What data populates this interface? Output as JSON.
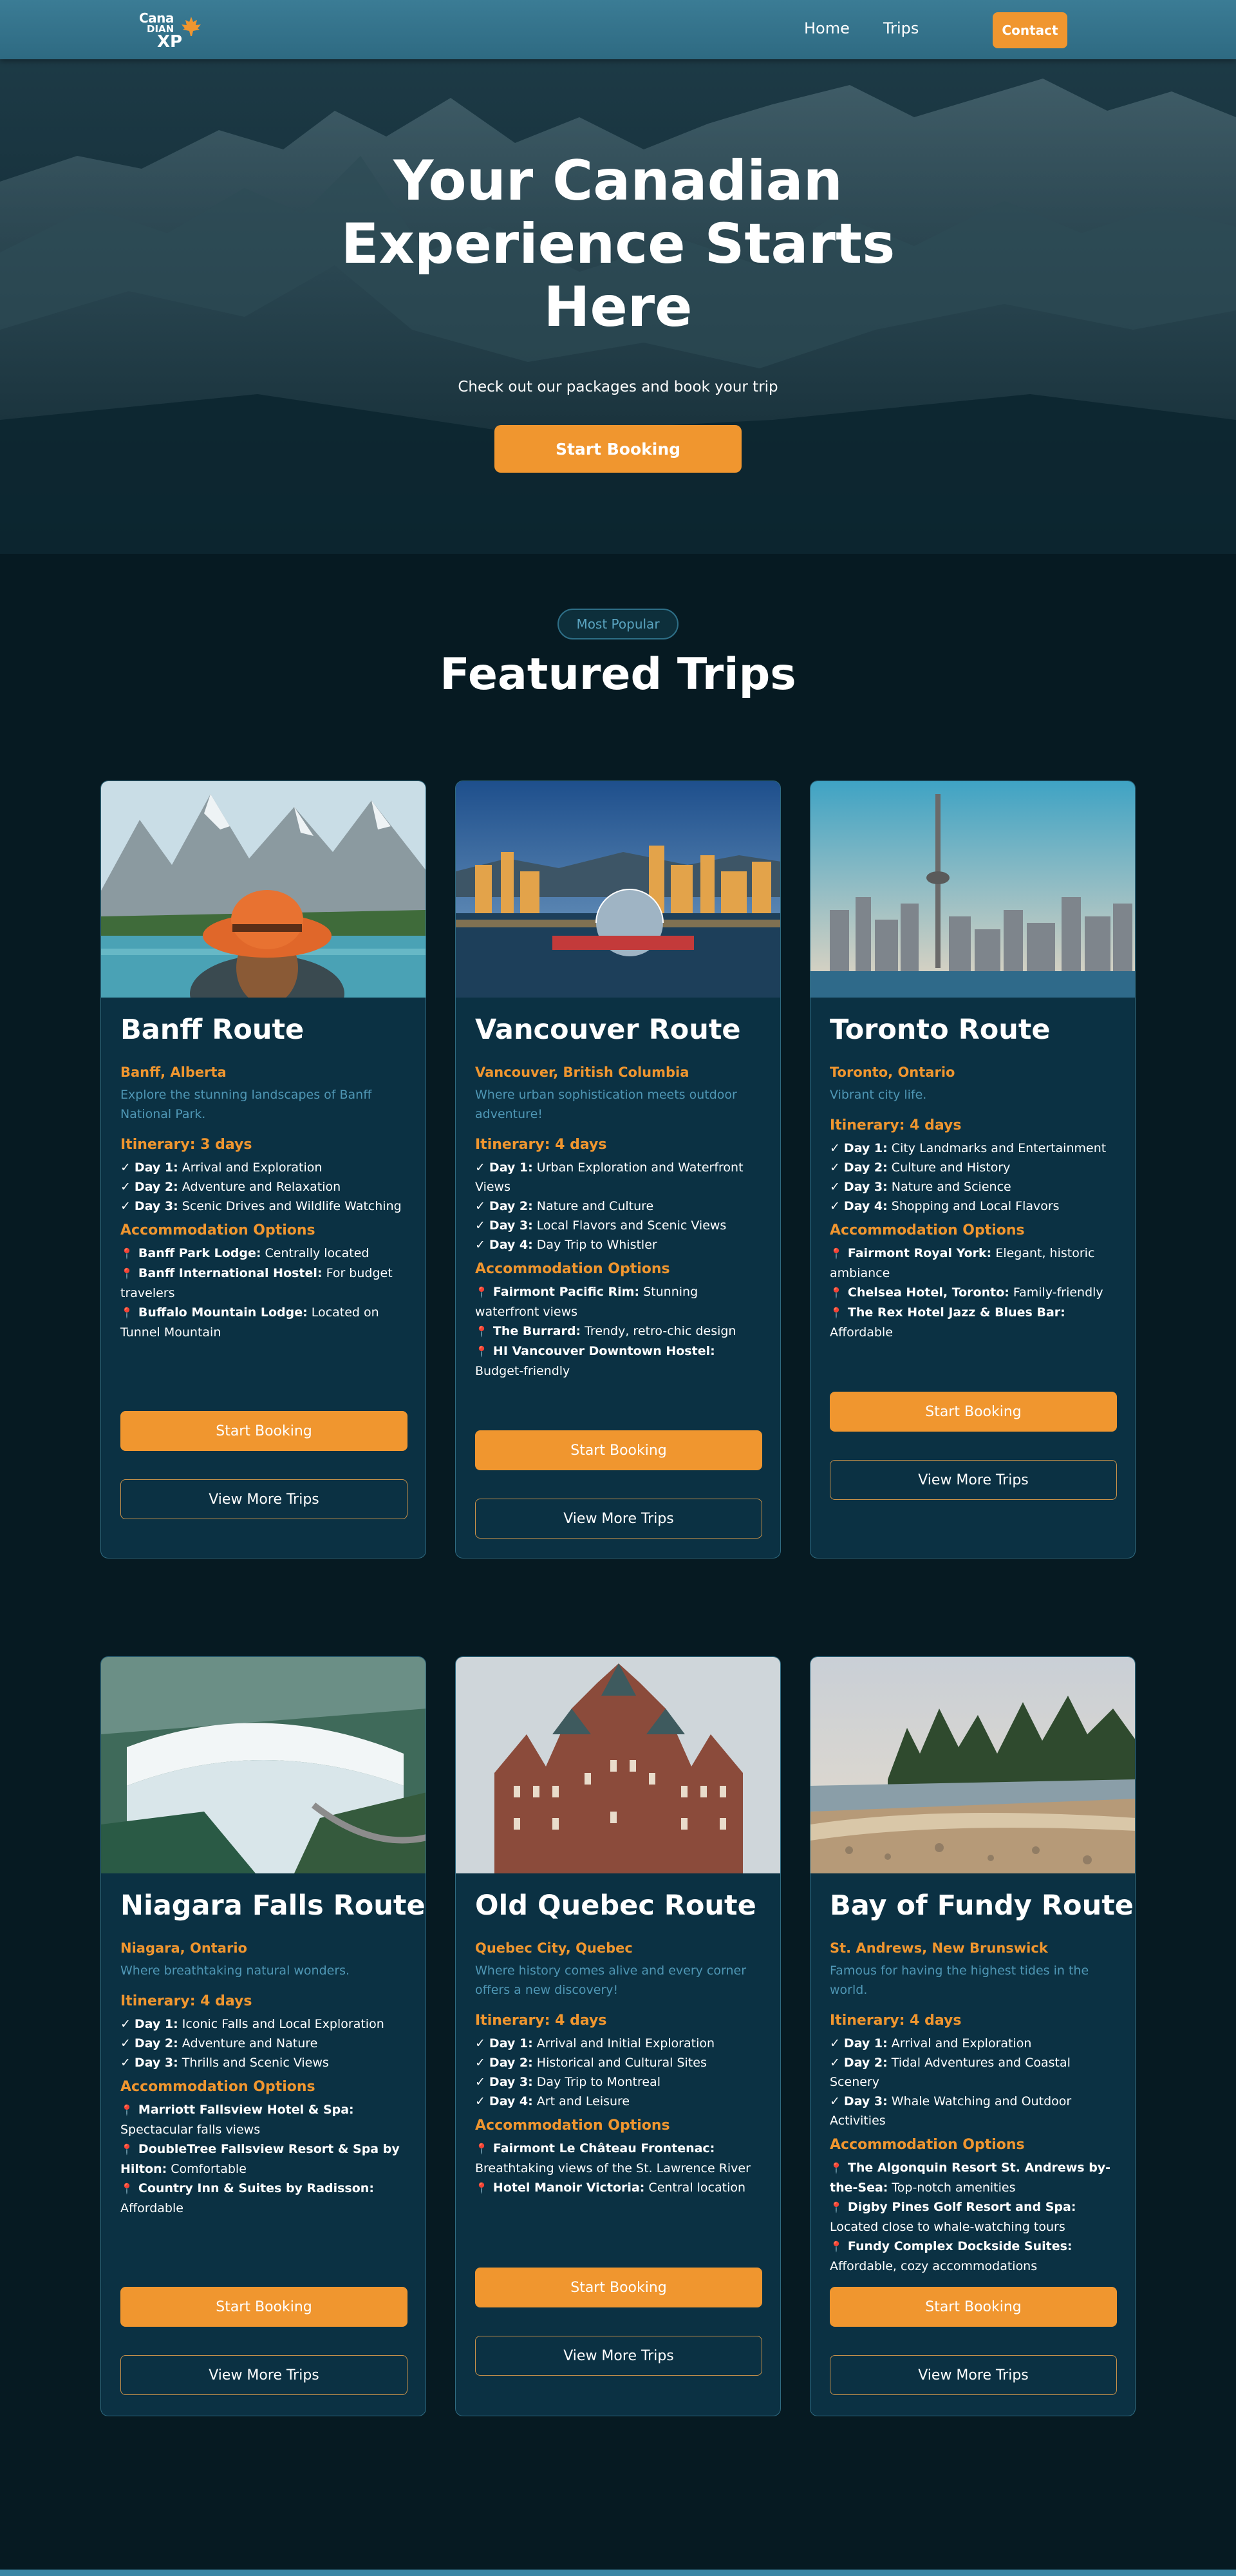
{
  "nav": {
    "logo_line1": "Cana",
    "logo_line2": "DIAN",
    "logo_line3": "XP",
    "home": "Home",
    "trips": "Trips",
    "contact": "Contact"
  },
  "hero": {
    "title": "Your Canadian Experience Starts Here",
    "subtitle": "Check out our packages and book your trip",
    "button": "Start Booking"
  },
  "featured": {
    "badge": "Most Popular",
    "title": "Featured Trips"
  },
  "common": {
    "itinerary_prefix": "Itinerary: ",
    "accommodation_heading": "Accommodation Options",
    "book_label": "Start Booking",
    "more_label": "View More Trips"
  },
  "trips": [
    {
      "title": "Banff Route",
      "location": "Banff, Alberta",
      "description": "Explore the stunning landscapes of Banff National Park.",
      "itinerary": "Itinerary: 3 days",
      "days": [
        {
          "day": "Day 1:",
          "text": "Arrival and Exploration"
        },
        {
          "day": "Day 2:",
          "text": "Adventure and Relaxation"
        },
        {
          "day": "Day 3:",
          "text": "Scenic Drives and Wildlife Watching"
        }
      ],
      "accommodation_heading": "Accommodation Options",
      "hotels": [
        {
          "name": "Banff Park Lodge:",
          "text": "Centrally located"
        },
        {
          "name": "Banff International Hostel:",
          "text": "For budget travelers"
        },
        {
          "name": "Buffalo Mountain Lodge:",
          "text": "Located on Tunnel Mountain"
        }
      ],
      "book": "Start Booking",
      "more": "View More Trips"
    },
    {
      "title": "Vancouver Route",
      "location": "Vancouver, British Columbia",
      "description": "Where urban sophistication meets outdoor adventure!",
      "itinerary": "Itinerary: 4 days",
      "days": [
        {
          "day": "Day 1:",
          "text": "Urban Exploration and Waterfront Views"
        },
        {
          "day": "Day 2:",
          "text": "Nature and Culture"
        },
        {
          "day": "Day 3:",
          "text": "Local Flavors and Scenic Views"
        },
        {
          "day": "Day 4:",
          "text": "Day Trip to Whistler"
        }
      ],
      "accommodation_heading": "Accommodation Options",
      "hotels": [
        {
          "name": "Fairmont Pacific Rim:",
          "text": "Stunning waterfront views"
        },
        {
          "name": "The Burrard:",
          "text": "Trendy, retro-chic design"
        },
        {
          "name": "HI Vancouver Downtown Hostel:",
          "text": "Budget-friendly"
        }
      ],
      "book": "Start Booking",
      "more": "View More Trips"
    },
    {
      "title": "Toronto Route",
      "location": "Toronto, Ontario",
      "description": "Vibrant city life.",
      "itinerary": "Itinerary: 4 days",
      "days": [
        {
          "day": "Day 1:",
          "text": "City Landmarks and Entertainment"
        },
        {
          "day": "Day 2:",
          "text": "Culture and History"
        },
        {
          "day": "Day 3:",
          "text": "Nature and Science"
        },
        {
          "day": "Day 4:",
          "text": "Shopping and Local Flavors"
        }
      ],
      "accommodation_heading": "Accommodation Options",
      "hotels": [
        {
          "name": "Fairmont Royal York:",
          "text": "Elegant, historic ambiance"
        },
        {
          "name": "Chelsea Hotel, Toronto:",
          "text": "Family-friendly"
        },
        {
          "name": "The Rex Hotel Jazz & Blues Bar:",
          "text": "Affordable"
        }
      ],
      "book": "Start Booking",
      "more": "View More Trips"
    },
    {
      "title": "Niagara Falls Route",
      "location": "Niagara, Ontario",
      "description": "Where breathtaking natural wonders.",
      "itinerary": "Itinerary: 4 days",
      "days": [
        {
          "day": "Day 1:",
          "text": "Iconic Falls and Local Exploration"
        },
        {
          "day": "Day 2:",
          "text": "Adventure and Nature"
        },
        {
          "day": "Day 3:",
          "text": "Thrills and Scenic Views"
        }
      ],
      "accommodation_heading": "Accommodation Options",
      "hotels": [
        {
          "name": "Marriott Fallsview Hotel & Spa:",
          "text": "Spectacular falls views"
        },
        {
          "name": "DoubleTree Fallsview Resort & Spa by Hilton:",
          "text": "Comfortable"
        },
        {
          "name": "Country Inn & Suites by Radisson:",
          "text": "Affordable"
        }
      ],
      "book": "Start Booking",
      "more": "View More Trips"
    },
    {
      "title": "Old Quebec Route",
      "location": "Quebec City, Quebec",
      "description": "Where history comes alive and every corner offers a new discovery!",
      "itinerary": "Itinerary: 4 days",
      "days": [
        {
          "day": "Day 1:",
          "text": "Arrival and Initial Exploration"
        },
        {
          "day": "Day 2:",
          "text": "Historical and Cultural Sites"
        },
        {
          "day": "Day 3:",
          "text": "Day Trip to Montreal"
        },
        {
          "day": "Day 4:",
          "text": "Art and Leisure"
        }
      ],
      "accommodation_heading": "Accommodation Options",
      "hotels": [
        {
          "name": "Fairmont Le Château Frontenac:",
          "text": "Breathtaking views of the St. Lawrence River"
        },
        {
          "name": "Hotel Manoir Victoria:",
          "text": "Central location"
        }
      ],
      "book": "Start Booking",
      "more": "View More Trips"
    },
    {
      "title": "Bay of Fundy Route",
      "location": "St. Andrews, New Brunswick",
      "description": "Famous for having the highest tides in the world.",
      "itinerary": "Itinerary: 4 days",
      "days": [
        {
          "day": "Day 1:",
          "text": "Arrival and Exploration"
        },
        {
          "day": "Day 2:",
          "text": "Tidal Adventures and Coastal Scenery"
        },
        {
          "day": "Day 3:",
          "text": "Whale Watching and Outdoor Activities"
        }
      ],
      "accommodation_heading": "Accommodation Options",
      "hotels": [
        {
          "name": "The Algonquin Resort St. Andrews by-the-Sea:",
          "text": "Top-notch amenities"
        },
        {
          "name": "Digby Pines Golf Resort and Spa:",
          "text": "Located close to whale-watching tours"
        },
        {
          "name": "Fundy Complex Dockside Suites:",
          "text": "Affordable, cozy accommodations"
        }
      ],
      "book": "Start Booking",
      "more": "View More Trips"
    }
  ],
  "colors": {
    "accent": "#f0962f",
    "background": "#061a22",
    "card": "#0b3143",
    "nav": "#3b7c95",
    "muted_text": "#4f97b5",
    "pin": "#e6337f"
  },
  "icons": {
    "logo": "maple-leaf-icon",
    "check": "check-icon",
    "pin": "pushpin-icon"
  }
}
